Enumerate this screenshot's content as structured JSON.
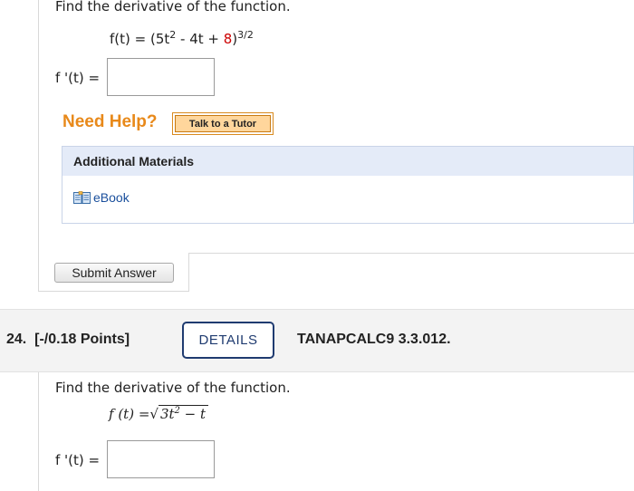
{
  "question23": {
    "prompt": "Find the derivative of the function.",
    "formula": {
      "lhs": "f(t) = (5t",
      "exp1": "2",
      "mid1": " - 4t + ",
      "const": "8",
      "close": ")",
      "exp2": "3/2"
    },
    "answer_label": "f '(t) =",
    "answer_value": "",
    "need_help": "Need Help?",
    "tutor_button": "Talk to a Tutor",
    "materials_header": "Additional Materials",
    "ebook_label": "eBook",
    "submit_button": "Submit Answer"
  },
  "question24": {
    "number": "24.",
    "points": "[-/0.18 Points]",
    "details_button": "DETAILS",
    "code": "TANAPCALC9 3.3.012.",
    "prompt": "Find the derivative of the function.",
    "formula": {
      "lhs": "f (t) = ",
      "radical_symbol": "√",
      "radicand_a": "3t",
      "radicand_exp": "2",
      "radicand_b": " − t"
    },
    "answer_label": "f '(t) =",
    "answer_value": ""
  },
  "colors": {
    "need_help": "#e8891a",
    "tutor_bg": "#ffd69c",
    "details_border": "#1f3b70",
    "materials_header_bg": "#e4ebf8",
    "ebook_link": "#1a4f9c",
    "highlight_red": "#cc0000"
  },
  "icons": {
    "ebook": "open-book-icon"
  }
}
